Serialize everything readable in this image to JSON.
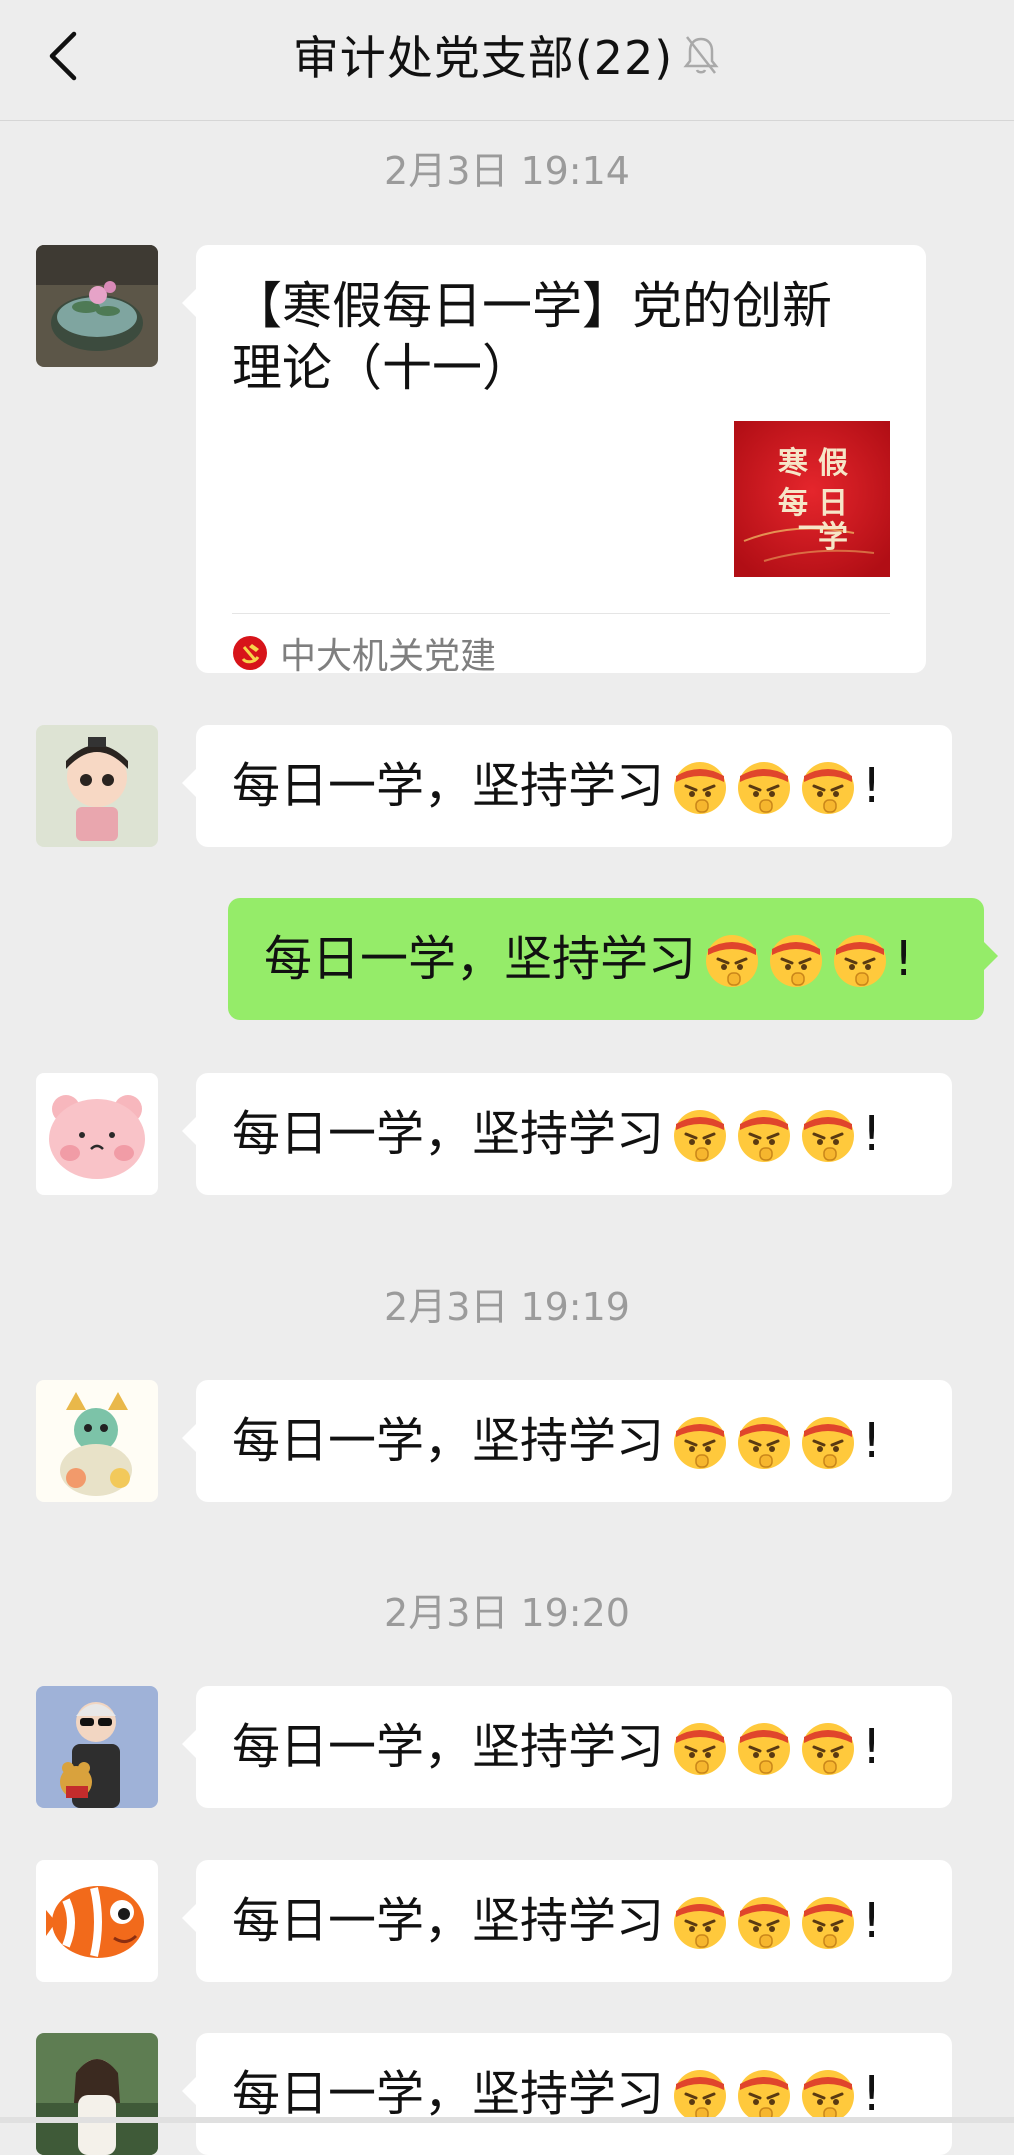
{
  "header": {
    "title": "审计处党支部(22)",
    "back_icon": "chevron-left-icon",
    "mute_icon": "bell-muted-icon"
  },
  "timestamps": [
    "2月3日 19:14",
    "2月3日 19:19",
    "2月3日 19:20"
  ],
  "card": {
    "title": "【寒假每日一学】党的创新理论（十一）",
    "thumb_text": [
      "寒",
      "假",
      "每",
      "日",
      "一",
      "学"
    ],
    "source": "中大机关党建",
    "source_icon": "party-emblem-icon"
  },
  "messages": [
    {
      "text": "每日一学，坚持学习",
      "suffix": "!",
      "emoji_count": 3,
      "mine": false
    },
    {
      "text": "每日一学，坚持学习",
      "suffix": "!",
      "emoji_count": 3,
      "mine": true
    },
    {
      "text": "每日一学，坚持学习",
      "suffix": "!",
      "emoji_count": 3,
      "mine": false
    },
    {
      "text": "每日一学，坚持学习",
      "suffix": "!",
      "emoji_count": 3,
      "mine": false
    },
    {
      "text": "每日一学，坚持学习",
      "suffix": "!",
      "emoji_count": 3,
      "mine": false
    },
    {
      "text": "每日一学，坚持学习",
      "suffix": "!",
      "emoji_count": 3,
      "mine": false
    },
    {
      "text": "每日一学，坚持学习",
      "suffix": "!",
      "emoji_count": 3,
      "mine": false
    }
  ],
  "emoji": "determined-face-emoji",
  "colors": {
    "background": "#EDEDED",
    "my_bubble": "#95EC69",
    "other_bubble": "#FFFFFF",
    "timestamp": "#9B9B9B",
    "card_thumb": "#C8141C"
  }
}
